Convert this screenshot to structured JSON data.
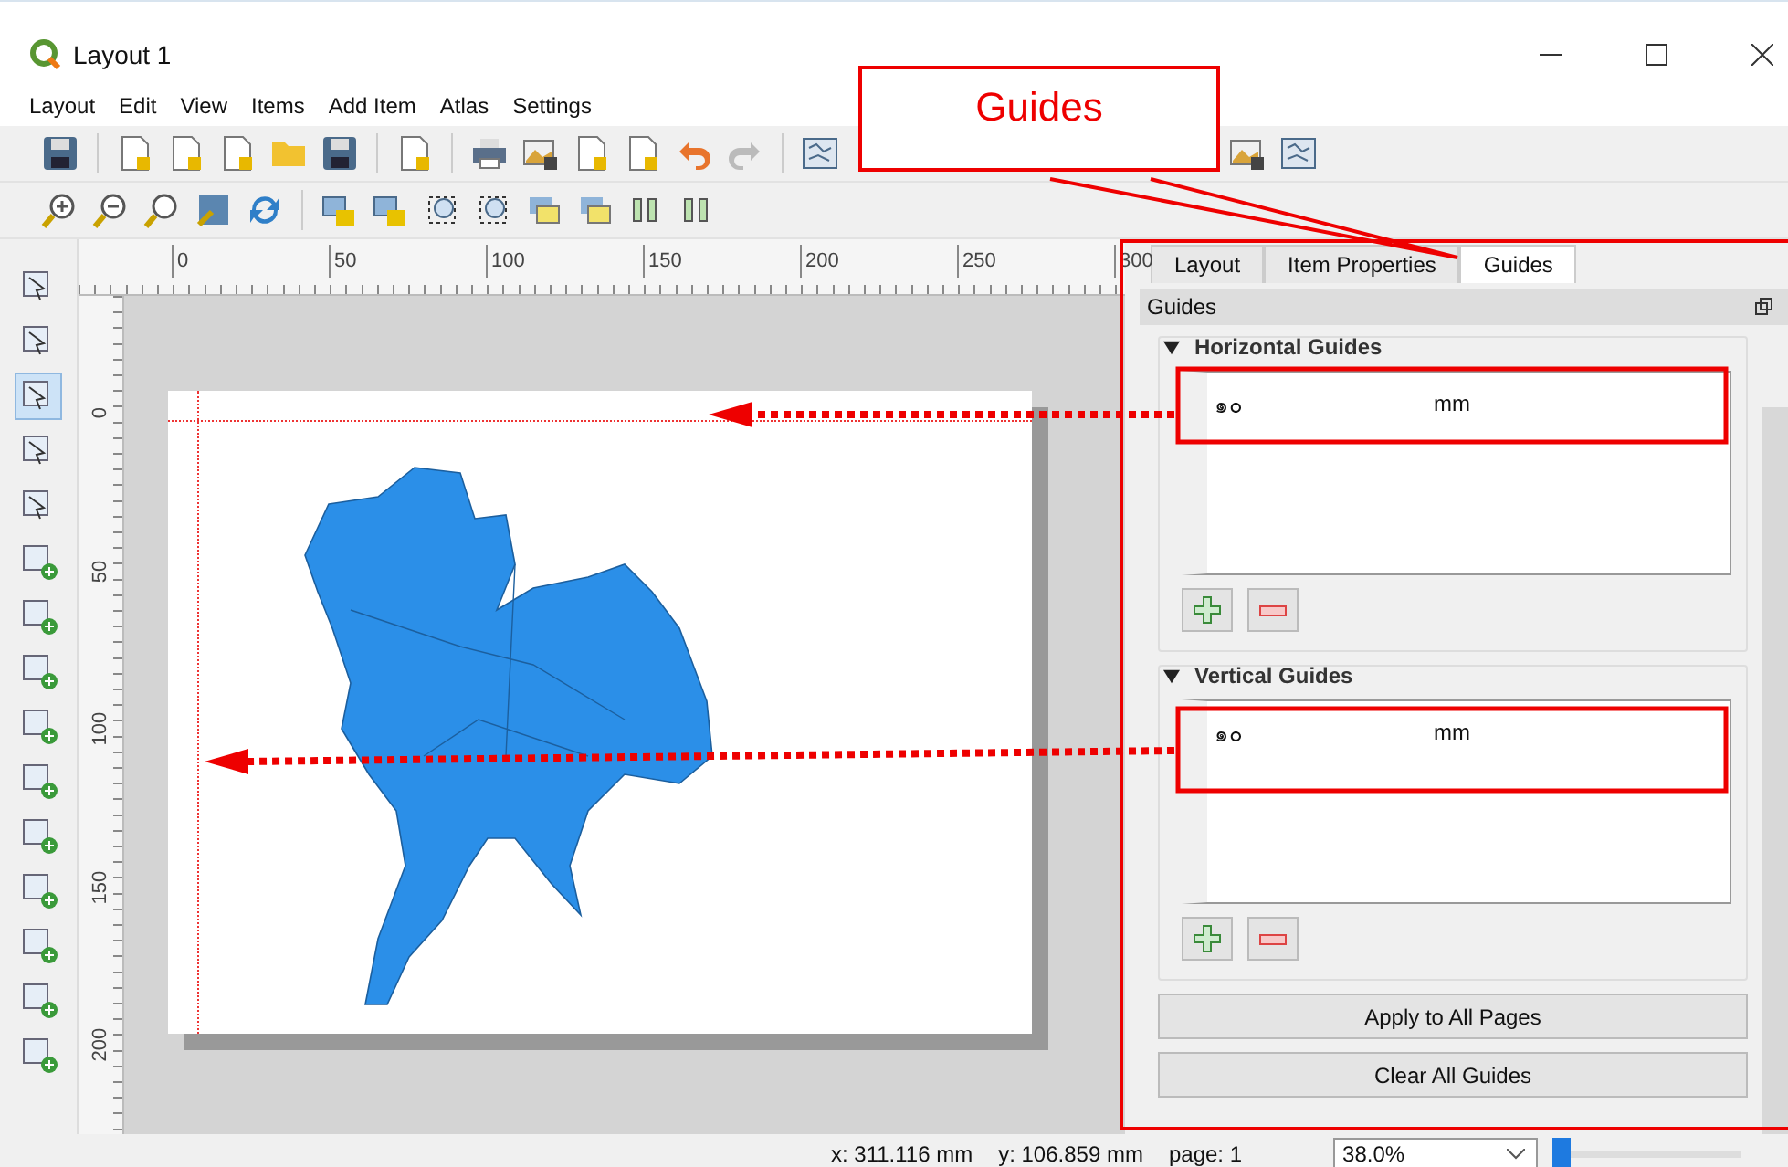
{
  "window": {
    "title": "Layout 1"
  },
  "menu": [
    "Layout",
    "Edit",
    "View",
    "Items",
    "Add Item",
    "Atlas",
    "Settings"
  ],
  "ruler": {
    "x_labels": [
      "0",
      "50",
      "100",
      "150",
      "200",
      "250",
      "300"
    ],
    "y_labels": [
      "0",
      "50",
      "100",
      "150",
      "200"
    ]
  },
  "panel": {
    "tabs": [
      {
        "label": "Layout",
        "selected": false
      },
      {
        "label": "Item Properties",
        "selected": false
      },
      {
        "label": "Guides",
        "selected": true
      }
    ],
    "title": "Guides",
    "sections": [
      {
        "title": "Horizontal Guides",
        "expanded": true,
        "rows": [
          {
            "value": "๑๐",
            "unit": "mm"
          }
        ]
      },
      {
        "title": "Vertical Guides",
        "expanded": true,
        "rows": [
          {
            "value": "๑๐",
            "unit": "mm"
          }
        ]
      }
    ],
    "buttons": [
      "Apply to All Pages",
      "Clear All Guides"
    ]
  },
  "callout": {
    "label": "Guides"
  },
  "status_bar": {
    "x": "x: 311.116 mm",
    "y": "y: 106.859 mm",
    "page": "page: 1",
    "zoom": "38.0%",
    "zoom_slider": {
      "level": 0.0
    }
  }
}
